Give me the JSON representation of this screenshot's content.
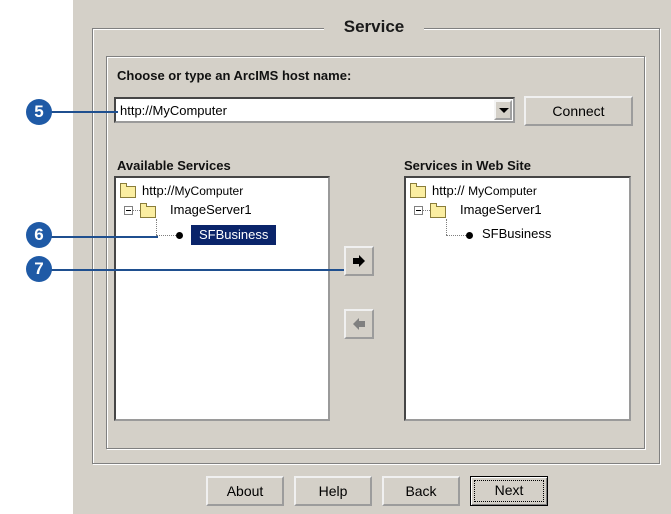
{
  "dialog": {
    "group_title": "Service",
    "host_prompt": "Choose or type an ArcIMS host name:",
    "host_value": "http://MyComputer",
    "connect_label": "Connect"
  },
  "available": {
    "label": "Available Services",
    "root": "http://",
    "root_host": "MyComputer",
    "server": "ImageServer1",
    "service": "SFBusiness"
  },
  "web_site": {
    "label": "Services in Web Site",
    "root": "http://",
    "root_host": "MyComputer",
    "server": "ImageServer1",
    "service": "SFBusiness"
  },
  "callouts": [
    "5",
    "6",
    "7"
  ],
  "footer": {
    "about": "About",
    "help": "Help",
    "back": "Back",
    "next": "Next"
  },
  "icons": {
    "add": "arrow-right-icon",
    "remove": "arrow-left-icon",
    "folder": "folder-icon",
    "service": "service-dot-icon"
  },
  "colors": {
    "dialog_bg": "#d4d0c8",
    "selection": "#0a246a",
    "callout": "#1f5aa6"
  }
}
